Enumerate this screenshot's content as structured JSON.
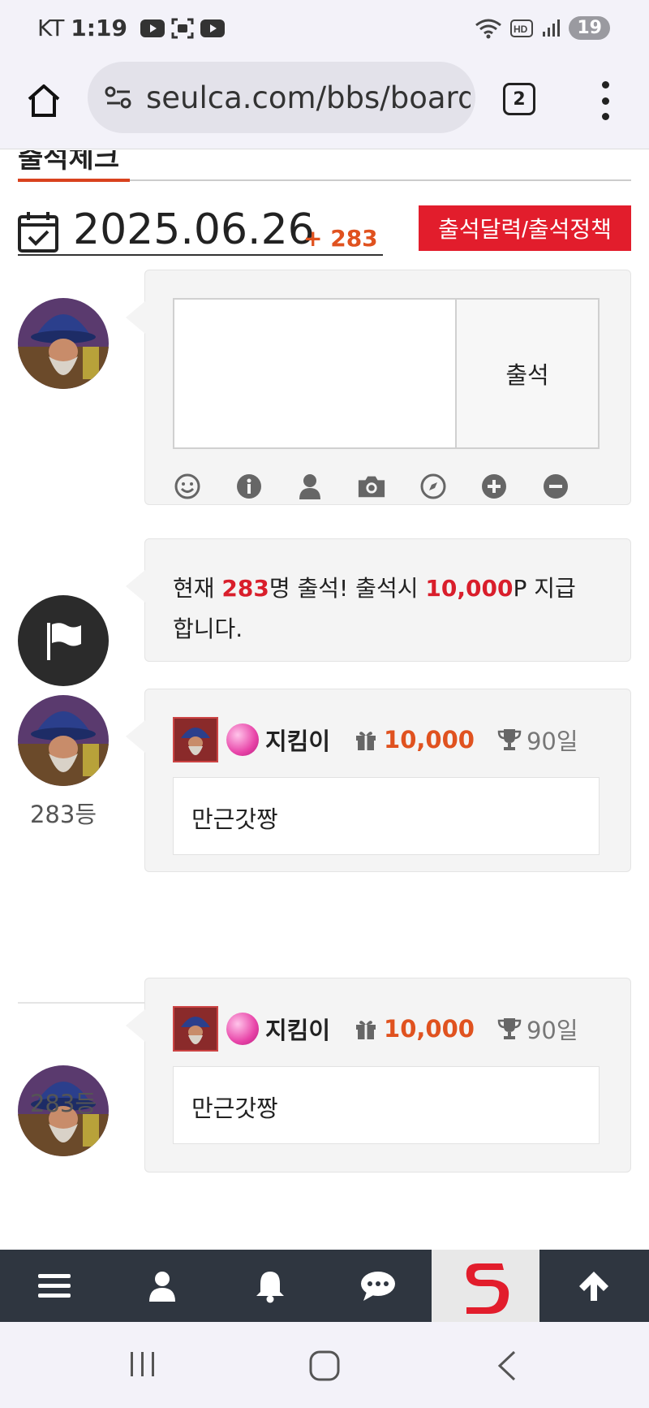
{
  "status_bar": {
    "carrier": "KT",
    "time": "1:19",
    "battery": "19"
  },
  "browser": {
    "url": "seulca.com/bbs/board",
    "tab_count": "2"
  },
  "page": {
    "partial_tab_title": "출석체크",
    "date": "2025.06.26",
    "date_count": "+ 283",
    "policy_button": "출석달력/출석정책"
  },
  "attend_form": {
    "textarea_value": "",
    "submit_label": "출석",
    "tools": [
      "smile-icon",
      "info-icon",
      "user-icon",
      "camera-icon",
      "compass-icon",
      "plus-icon",
      "minus-icon"
    ]
  },
  "notice": {
    "prefix": "현재 ",
    "count": "283",
    "middle": "명 출석! 출석시 ",
    "points": "10,000",
    "suffix": "P 지급합니다."
  },
  "entries": [
    {
      "rank": "283등",
      "nickname": "지킴이",
      "points": "10,000",
      "days": "90일",
      "comment": "만근갓짱"
    },
    {
      "rank": "283등",
      "nickname": "지킴이",
      "points": "10,000",
      "days": "90일",
      "comment": "만근갓짱"
    }
  ],
  "bottom_nav": [
    "menu-icon",
    "user-icon",
    "bell-icon",
    "chat-icon",
    "site-logo",
    "arrow-up-icon"
  ],
  "colors": {
    "accent_red": "#e21d2c",
    "accent_orange": "#e0521f",
    "nav_bg": "#2f3640"
  }
}
